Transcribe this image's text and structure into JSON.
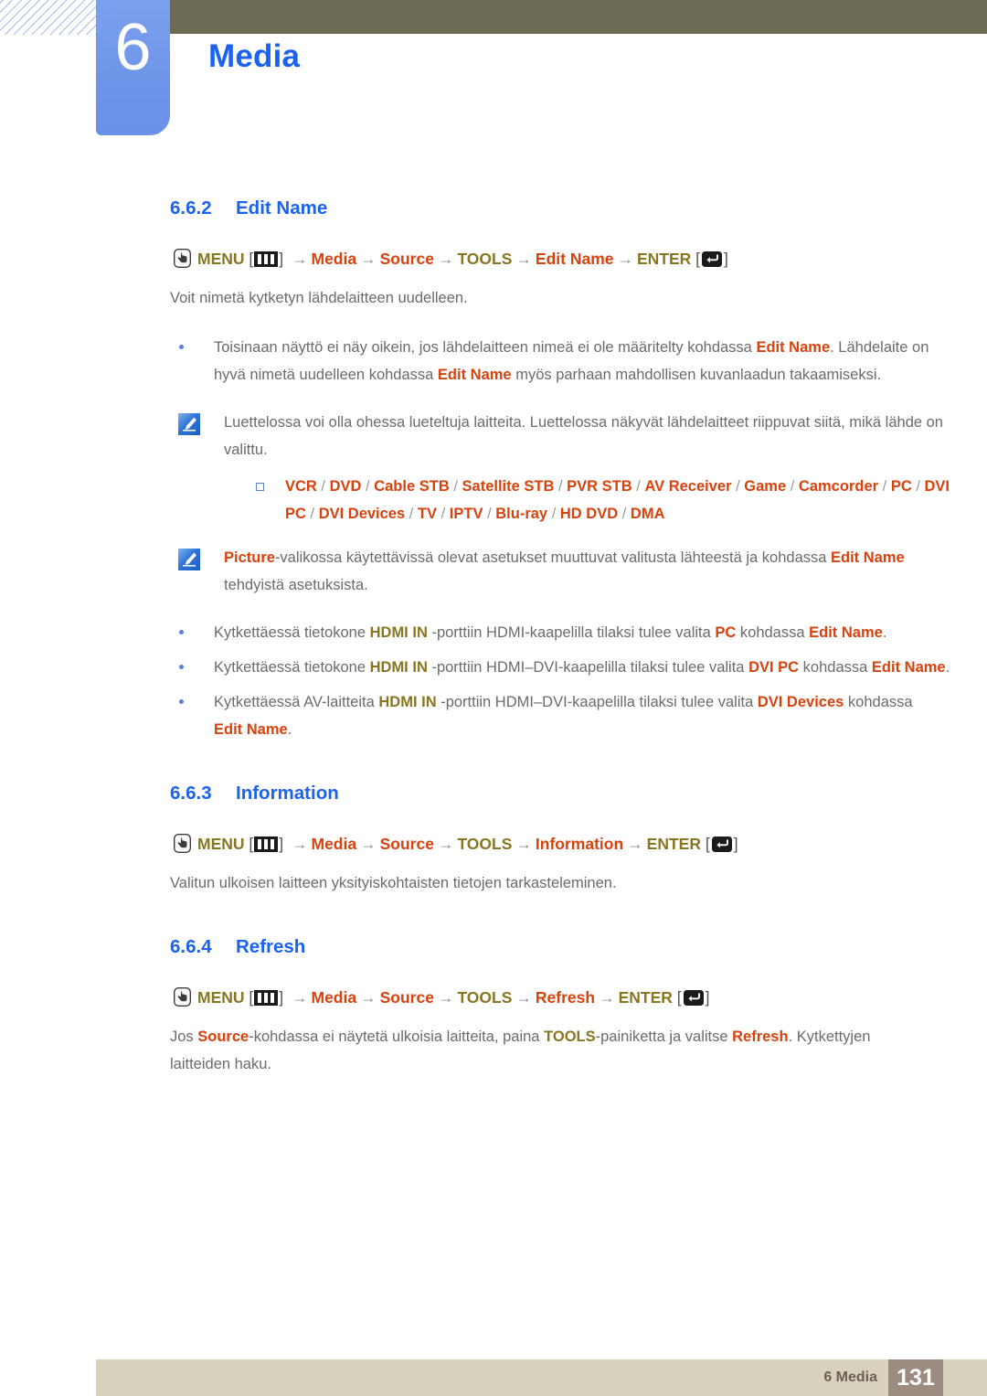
{
  "header": {
    "chapter_number": "6",
    "chapter_title": "Media",
    "hatch_icon": "diagonal-hatch-pattern",
    "colors": {
      "tab": "#6f95ea",
      "bar": "#6d6b54",
      "title": "#1a62f0"
    }
  },
  "sections": [
    {
      "number": "6.6.2",
      "title": "Edit Name",
      "menu_path": {
        "hand_icon": "hand-press-icon",
        "menu_label": "MENU",
        "menu_key_icon": "menu-key-icon",
        "arrow": "→",
        "steps": [
          "Media",
          "Source",
          "TOOLS",
          "Edit Name"
        ],
        "enter_label": "ENTER",
        "enter_key_icon": "enter-key-icon",
        "bracket_open": "[",
        "bracket_close": "]"
      },
      "intro": "Voit nimetä kytketyn lähdelaitteen uudelleen."
    },
    {
      "number": "6.6.3",
      "title": "Information",
      "menu_path": {
        "hand_icon": "hand-press-icon",
        "menu_label": "MENU",
        "menu_key_icon": "menu-key-icon",
        "arrow": "→",
        "steps": [
          "Media",
          "Source",
          "TOOLS",
          "Information"
        ],
        "enter_label": "ENTER",
        "enter_key_icon": "enter-key-icon"
      },
      "intro": "Valitun ulkoisen laitteen yksityiskohtaisten tietojen tarkasteleminen."
    },
    {
      "number": "6.6.4",
      "title": "Refresh",
      "menu_path": {
        "hand_icon": "hand-press-icon",
        "menu_label": "MENU",
        "menu_key_icon": "menu-key-icon",
        "arrow": "→",
        "steps": [
          "Media",
          "Source",
          "TOOLS",
          "Refresh"
        ],
        "enter_label": "ENTER",
        "enter_key_icon": "enter-key-icon"
      }
    }
  ],
  "bullet1": {
    "t1": "Toisinaan näyttö ei näy oikein, jos lähdelaitteen nimeä ei ole määritelty kohdassa ",
    "k1": "Edit Name",
    "t2": ". Lähdelaite on hyvä nimetä uudelleen kohdassa ",
    "k2": "Edit Name",
    "t3": " myös parhaan mahdollisen kuvanlaadun takaamiseksi."
  },
  "note1": {
    "icon": "note-pen-icon",
    "text": "Luettelossa voi olla ohessa lueteltuja laitteita. Luettelossa näkyvät lähdelaitteet riippuvat siitä, mikä lähde on valittu."
  },
  "device_list": {
    "bullet_icon": "square-bullet-icon",
    "line1": [
      "VCR",
      "DVD",
      "Cable STB",
      "Satellite STB",
      "PVR STB",
      "AV Receiver",
      "Game",
      "Camcorder"
    ],
    "line2": [
      "PC",
      "DVI PC",
      "DVI Devices",
      "TV",
      "IPTV",
      "Blu-ray",
      "HD DVD",
      "DMA"
    ],
    "separator": "/"
  },
  "note2": {
    "icon": "note-pen-icon",
    "k1": "Picture",
    "t1": "-valikossa käytettävissä olevat asetukset muuttuvat valitusta lähteestä ja kohdassa ",
    "k2": "Edit Name",
    "t2": " tehdyistä asetuksista."
  },
  "hdmi_bullets": [
    {
      "t1": "Kytkettäessä tietokone ",
      "k1": "HDMI IN",
      "t2": " -porttiin HDMI-kaapelilla tilaksi tulee valita ",
      "k2": "PC",
      "t3": " kohdassa ",
      "k3": "Edit Name",
      "t4": "."
    },
    {
      "t1": "Kytkettäessä tietokone ",
      "k1": "HDMI IN",
      "t2": " -porttiin HDMI–DVI-kaapelilla tilaksi tulee valita ",
      "k2": "DVI PC",
      "t3": " kohdassa ",
      "k3": "Edit Name",
      "t4": "."
    },
    {
      "t1": "Kytkettäessä AV-laitteita ",
      "k1": "HDMI IN",
      "t2": " -porttiin HDMI–DVI-kaapelilla tilaksi tulee valita ",
      "k2": "DVI Devices",
      "t3": " kohdassa ",
      "k3": "Edit Name",
      "t4": "."
    }
  ],
  "refresh_body": {
    "t1": "Jos ",
    "k1": "Source",
    "t2": "-kohdassa ei näytetä ulkoisia laitteita, paina ",
    "k2": "TOOLS",
    "t3": "-painiketta ja valitse ",
    "k3": "Refresh",
    "t4": ". Kytkettyjen laitteiden haku."
  },
  "footer": {
    "label": "6 Media",
    "page_number": "131",
    "colors": {
      "bar": "#d8d2bd",
      "page_box": "#9b8b80"
    }
  }
}
